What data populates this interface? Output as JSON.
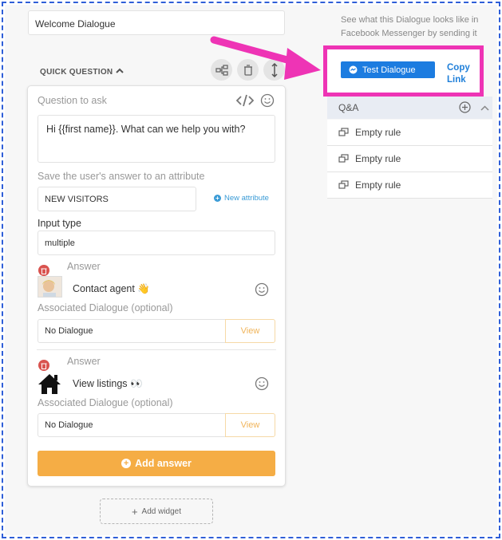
{
  "widget": {
    "title_value": "Welcome Dialogue",
    "section_label": "QUICK QUESTION"
  },
  "question": {
    "label": "Question to ask",
    "text": "Hi {{first name}}. What can we help you with?"
  },
  "attribute": {
    "label": "Save the user's answer to an attribute",
    "value": "NEW VISITORS",
    "new_attr_label": "New attribute"
  },
  "input_type": {
    "label": "Input type",
    "value": "multiple"
  },
  "answers": [
    {
      "label": "Answer",
      "text": "Contact agent 👋",
      "dialogue_label": "Associated Dialogue (optional)",
      "dialogue_value": "No Dialogue",
      "view_label": "View"
    },
    {
      "label": "Answer",
      "text": "View listings 👀",
      "dialogue_label": "Associated Dialogue (optional)",
      "dialogue_value": "No Dialogue",
      "view_label": "View"
    }
  ],
  "add_answer_label": "Add answer",
  "add_widget_label": "Add widget",
  "sidebar": {
    "description": "See what this Dialogue looks like in Facebook Messenger by sending it",
    "test_button_label": "Test Dialogue",
    "copy_link_label": "Copy Link",
    "qa_header": "Q&A",
    "rules": [
      "Empty rule",
      "Empty rule",
      "Empty rule"
    ]
  },
  "colors": {
    "accent_orange": "#f5ad45",
    "messenger_blue": "#1c7ce0",
    "highlight_pink": "#ee34b5",
    "delete_red": "#d9534f",
    "frame_blue": "#2f5fd8"
  }
}
